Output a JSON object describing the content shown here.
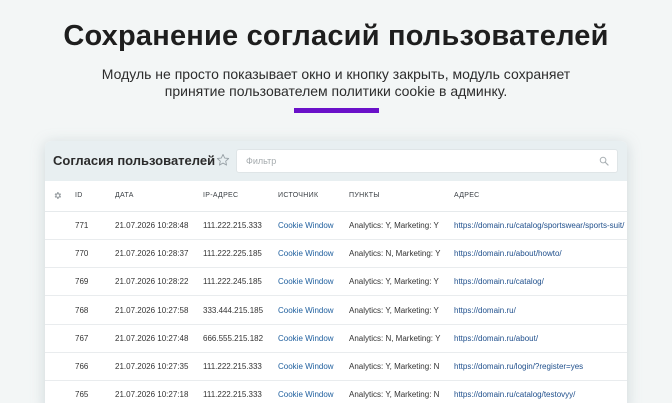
{
  "hero": {
    "title": "Сохранение согласий пользователей",
    "subtitle_line1": "Модуль не просто показывает окно и кнопку закрыть, модуль сохраняет",
    "subtitle_line2": "принятие пользователем политики cookie в админку.",
    "accent_color": "#6a11c9"
  },
  "panel": {
    "title": "Согласия пользователей",
    "filter_placeholder": "Фильтр",
    "filter_value": ""
  },
  "table": {
    "columns": [
      "ID",
      "ДАТА",
      "IP-АДРЕС",
      "ИСТОЧНИК",
      "ПУНКТЫ",
      "АДРЕС"
    ],
    "rows": [
      {
        "id": "771",
        "date": "21.07.2026 10:28:48",
        "ip": "111.222.215.333",
        "source": "Cookie Window",
        "items": "Analytics: Y, Marketing: Y",
        "url": "https://domain.ru/catalog/sportswear/sports-suit/"
      },
      {
        "id": "770",
        "date": "21.07.2026 10:28:37",
        "ip": "111.222.225.185",
        "source": "Cookie Window",
        "items": "Analytics: N, Marketing: Y",
        "url": "https://domain.ru/about/howto/"
      },
      {
        "id": "769",
        "date": "21.07.2026 10:28:22",
        "ip": "111.222.245.185",
        "source": "Cookie Window",
        "items": "Analytics: Y, Marketing: Y",
        "url": "https://domain.ru/catalog/"
      },
      {
        "id": "768",
        "date": "21.07.2026 10:27:58",
        "ip": "333.444.215.185",
        "source": "Cookie Window",
        "items": "Analytics: Y, Marketing: Y",
        "url": "https://domain.ru/"
      },
      {
        "id": "767",
        "date": "21.07.2026 10:27:48",
        "ip": "666.555.215.182",
        "source": "Cookie Window",
        "items": "Analytics: N, Marketing: Y",
        "url": "https://domain.ru/about/"
      },
      {
        "id": "766",
        "date": "21.07.2026 10:27:35",
        "ip": "111.222.215.333",
        "source": "Cookie Window",
        "items": "Analytics: Y, Marketing: N",
        "url": "https://domain.ru/login/?register=yes"
      },
      {
        "id": "765",
        "date": "21.07.2026 10:27:18",
        "ip": "111.222.215.333",
        "source": "Cookie Window",
        "items": "Analytics: Y, Marketing: N",
        "url": "https://domain.ru/catalog/testovyy/"
      }
    ]
  },
  "icons": {
    "star": "star-icon",
    "search": "search-icon",
    "settings": "gear-icon"
  }
}
